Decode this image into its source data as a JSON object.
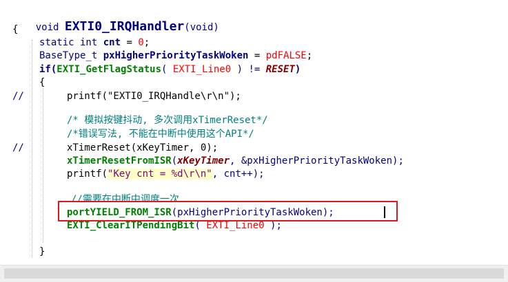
{
  "code": {
    "l1_void": "void ",
    "l1_fn": "EXTI0_IRQHandler",
    "l1_args": "(void)",
    "l2": "{",
    "l3_kw": "static int ",
    "l3_var": "cnt",
    "l3_eq": " = ",
    "l3_num": "0",
    "l3_end": ";",
    "l4_type": "BaseType_t ",
    "l4_var": "pxHigherPriorityTaskWoken",
    "l4_eq": " = ",
    "l4_val": "pdFALSE",
    "l4_end": ";",
    "l5_if": "if",
    "l5_open": "(",
    "l5_fn": "EXTI_GetFlagStatus",
    "l5_p1": "( ",
    "l5_arg": "EXTI_Line0",
    "l5_p2": " ) != ",
    "l5_reset": "RESET",
    "l5_close": ")",
    "l6": "{",
    "l7_mark": "//",
    "l7": "printf(\"EXTI0_IRQHandle\\r\\n\");",
    "l8": "/* 模拟按键抖动, 多次调用xTimerReset*/",
    "l9": "/*错误写法, 不能在中断中使用这个API*/",
    "l10_mark": "//",
    "l10": "xTimerReset(xKeyTimer, 0);",
    "l11_fn": "xTimerResetFromISR",
    "l11_p1": "(",
    "l11_arg": "xKeyTimer",
    "l11_rest": ", &pxHigherPriorityTaskWoken);",
    "l12_a": "printf(",
    "l12_str": "\"Key cnt = %d\\r\\n\"",
    "l12_b": ", cnt++);",
    "l13": "//需要在中断中调度一次",
    "l14_fn": "portYIELD_FROM_ISR",
    "l14_rest": "(pxHigherPriorityTaskWoken);",
    "l15_fn": "EXTI_ClearITPendingBit",
    "l15_p1": "( ",
    "l15_arg": "EXTI_Line0",
    "l15_p2": " );",
    "l16": "}"
  },
  "colors": {
    "keyword": "#000080",
    "function_green": "#008000",
    "comment": "#008080",
    "macro": "#ff0000",
    "highlight_box": "#e2151d"
  }
}
